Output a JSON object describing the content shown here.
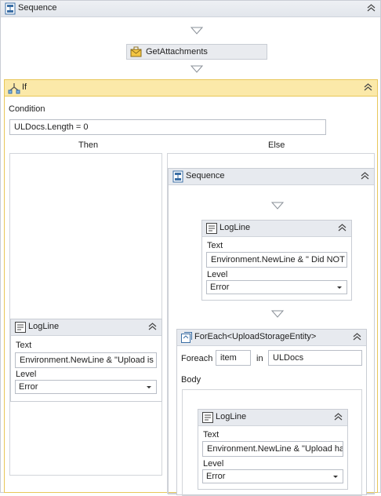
{
  "outer_sequence": {
    "title": "Sequence",
    "icon": "sequence-icon"
  },
  "get_attachments": {
    "label": "GetAttachments",
    "icon": "envelope-attachment-icon"
  },
  "if_activity": {
    "title": "If",
    "icon": "branch-icon",
    "condition_label": "Condition",
    "condition_value": "ULDocs.Length = 0",
    "then_label": "Then",
    "else_label": "Else"
  },
  "then_logline": {
    "title": "LogLine",
    "text_label": "Text",
    "text_value": "Environment.NewLine & \"Upload is",
    "level_label": "Level",
    "level_value": "Error"
  },
  "else_sequence": {
    "title": "Sequence",
    "icon": "sequence-icon"
  },
  "else_logline": {
    "title": "LogLine",
    "text_label": "Text",
    "text_value": "Environment.NewLine & \" Did NOT",
    "level_label": "Level",
    "level_value": "Error"
  },
  "foreach": {
    "title": "ForEach<UploadStorageEntity>",
    "foreach_label": "Foreach",
    "item_value": "item",
    "in_label": "in",
    "in_value": "ULDocs",
    "body_label": "Body"
  },
  "foreach_logline": {
    "title": "LogLine",
    "text_label": "Text",
    "text_value": "Environment.NewLine & \"Upload ha",
    "level_label": "Level",
    "level_value": "Error"
  },
  "colors": {
    "header_bg": "#e7eaef",
    "if_header_bg": "#fbe9a9",
    "if_border": "#e8c75a",
    "border": "#c9cdd4"
  }
}
